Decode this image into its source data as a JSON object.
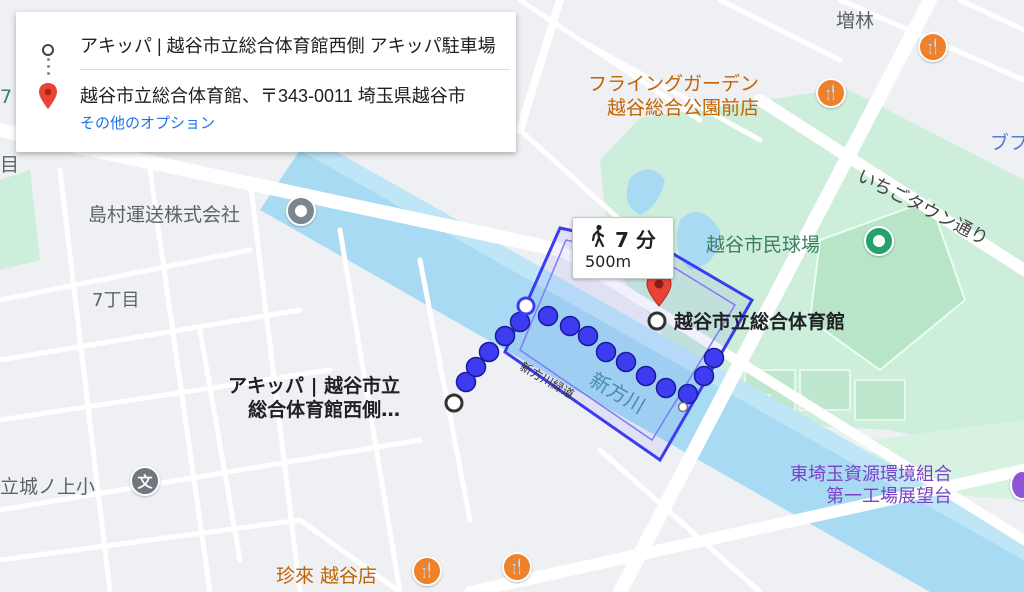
{
  "directions": {
    "origin": "アキッパ | 越谷市立総合体育館西側 アキッパ駐車場",
    "destination": "越谷市立総合体育館、〒343-0011 埼玉県越谷市",
    "more_options": "その他のオプション"
  },
  "route": {
    "mode_icon": "walking-person-icon",
    "duration": "7 分",
    "distance": "500m"
  },
  "markers": {
    "origin_label_line1": "アキッパ | 越谷市立",
    "origin_label_line2": "総合体育館西側…",
    "destination_label": "越谷市立総合体育館"
  },
  "map_labels": {
    "masubayashi": "増林",
    "flying_garden_line1": "フライングガーデン",
    "flying_garden_line2": "越谷総合公園前店",
    "shimamura": "島村運送株式会社",
    "baseball": "越谷市民球場",
    "ichigo_town_street": "いちごタウン通り",
    "nanachome": "7丁目",
    "shinkata_river": "新方川",
    "shinkata_greenway": "新方川緑道",
    "school": "立城ノ上小",
    "school_icon_glyph": "文",
    "higashi_saitama_line1": "東埼玉資源環境組合",
    "higashi_saitama_line2": "第一工場展望台",
    "chinrai": "珍來 越谷店",
    "edge_blue": "ブフ",
    "edge_seven": "7",
    "edge_me": "目"
  },
  "colors": {
    "route_fill": "#3d3cf0",
    "route_outline": "#3333e0",
    "water": "#a8dbf3",
    "park": "#c9eed8",
    "road": "#ffffff",
    "link": "#1a73e8",
    "marker_red": "#ea4335"
  },
  "icons": {
    "origin": "origin-ring-icon",
    "destination": "red-pin-icon",
    "restaurant": "restaurant-fork-knife-icon",
    "company": "business-pin-icon",
    "stadium": "stadium-pin-icon",
    "viewpoint": "viewpoint-pin-icon"
  }
}
